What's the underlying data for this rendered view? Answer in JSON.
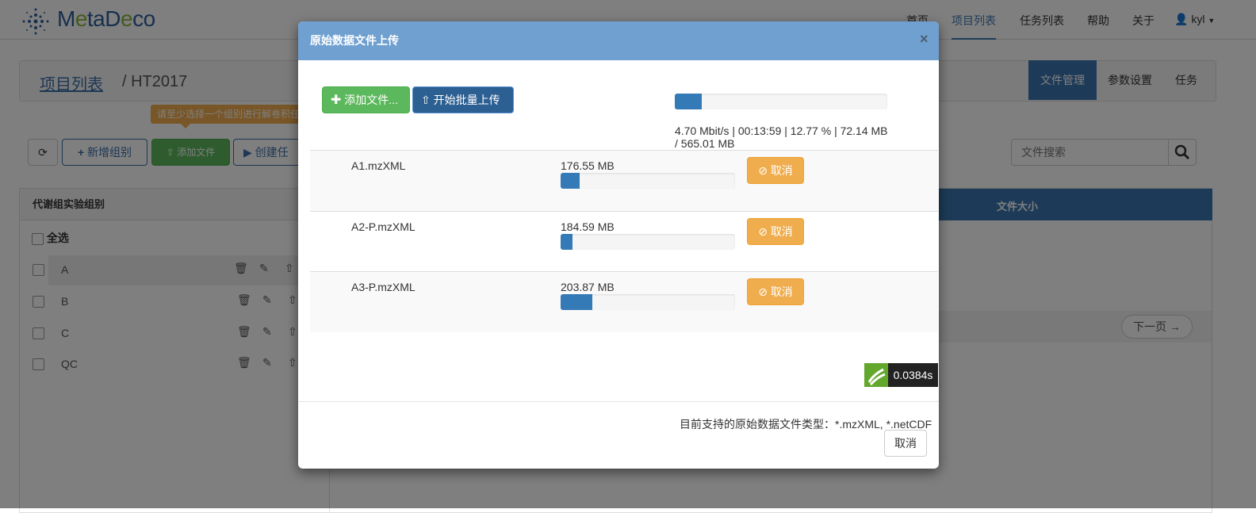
{
  "app": {
    "logo_text_part1": "M",
    "logo_text_part2": "e",
    "logo_text_part3": "taD",
    "logo_text_part4": "e",
    "logo_text_part5": "co"
  },
  "navbar": {
    "items": [
      {
        "label": "首页"
      },
      {
        "label": "项目列表"
      },
      {
        "label": "任务列表"
      },
      {
        "label": "帮助"
      },
      {
        "label": "关于"
      }
    ],
    "user": "kyl"
  },
  "breadcrumb": {
    "link": "项目列表",
    "current": "/ HT2017"
  },
  "right_tabs": [
    "文件管理",
    "参数设置",
    "任务"
  ],
  "toolbar": {
    "tooltip": "请至少选择一个组别进行解卷积任务",
    "new_group": "新增组别",
    "add_file": "添加文件",
    "create_task": "创建任"
  },
  "search": {
    "placeholder": "文件搜索"
  },
  "groups_panel": {
    "title": "代谢组实验组别",
    "select_all": "全选",
    "groups": [
      "A",
      "B",
      "C",
      "QC"
    ]
  },
  "files_table": {
    "col_size": "文件大小",
    "next_page": "下一页 →"
  },
  "modal": {
    "title": "原始数据文件上传",
    "close": "×",
    "add_files_label": "添加文件...",
    "start_upload_label": "开始批量上传",
    "total_progress": 0.1277,
    "total_stats_line1": "4.70 Mbit/s | 00:13:59 | 12.77 % | 72.14 MB",
    "total_stats_line2": "/ 565.01 MB",
    "files": [
      {
        "name": "A1.mzXML",
        "size": "176.55 MB",
        "progress": 0.11,
        "cancel": "取消"
      },
      {
        "name": "A2-P.mzXML",
        "size": "184.59 MB",
        "progress": 0.07,
        "cancel": "取消"
      },
      {
        "name": "A3-P.mzXML",
        "size": "203.87 MB",
        "progress": 0.18,
        "cancel": "取消"
      }
    ],
    "timer": "0.0384s",
    "footer_note": "目前支持的原始数据文件类型：*.mzXML, *.netCDF",
    "footer_cancel": "取消"
  },
  "colors": {
    "primary": "#337ab7",
    "success": "#5cb85c",
    "warning": "#f0ad4e",
    "modal_header": "#6fa0d0"
  }
}
